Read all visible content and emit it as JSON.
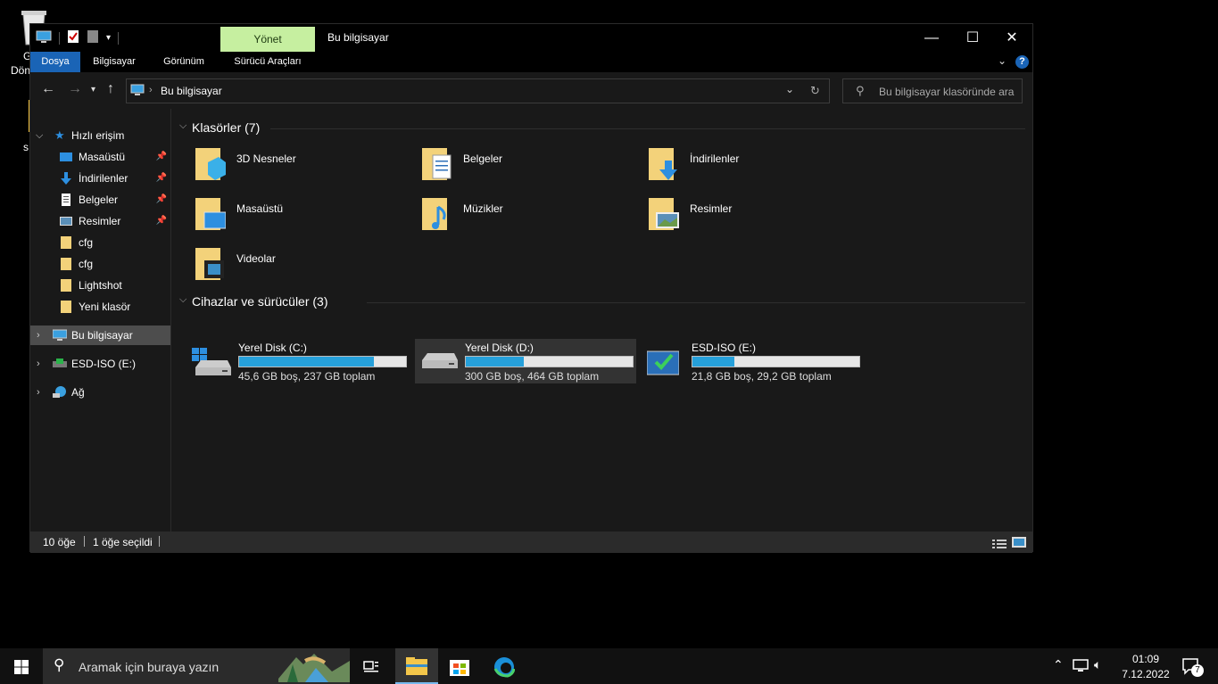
{
  "window": {
    "title": "Bu bilgisayar",
    "manage_tab": "Yönet",
    "controls": {
      "minimize": "—",
      "maximize": "☐",
      "close": "✕"
    }
  },
  "ribbon": {
    "tabs": [
      "Dosya",
      "Bilgisayar",
      "Görünüm",
      "Sürücü Araçları"
    ]
  },
  "address": {
    "path": "Bu bilgisayar",
    "search_placeholder": "Bu bilgisayar klasöründe ara"
  },
  "sidebar": {
    "quick_access": "Hızlı erişim",
    "items": [
      {
        "label": "Masaüstü",
        "icon": "desktop-icon",
        "pinned": true
      },
      {
        "label": "İndirilenler",
        "icon": "downloads-icon",
        "pinned": true
      },
      {
        "label": "Belgeler",
        "icon": "documents-icon",
        "pinned": true
      },
      {
        "label": "Resimler",
        "icon": "pictures-icon",
        "pinned": true
      },
      {
        "label": "cfg",
        "icon": "folder-icon",
        "pinned": false
      },
      {
        "label": "cfg",
        "icon": "folder-icon",
        "pinned": false
      },
      {
        "label": "Lightshot",
        "icon": "folder-icon",
        "pinned": false
      },
      {
        "label": "Yeni klasör",
        "icon": "folder-icon",
        "pinned": false
      }
    ],
    "this_pc": "Bu bilgisayar",
    "esd": "ESD-ISO (E:)",
    "network": "Ağ"
  },
  "content": {
    "folders_header": "Klasörler (7)",
    "folders": [
      "3D Nesneler",
      "Belgeler",
      "İndirilenler",
      "Masaüstü",
      "Müzikler",
      "Resimler",
      "Videolar"
    ],
    "drives_header": "Cihazlar ve sürücüler (3)",
    "drives": [
      {
        "name": "Yerel Disk (C:)",
        "info": "45,6 GB boş, 237 GB toplam",
        "used_fraction": 0.81
      },
      {
        "name": "Yerel Disk (D:)",
        "info": "300 GB boş, 464 GB toplam",
        "used_fraction": 0.35
      },
      {
        "name": "ESD-ISO (E:)",
        "info": "21,8 GB boş, 29,2 GB toplam",
        "used_fraction": 0.25
      }
    ]
  },
  "status": {
    "count": "10 öğe",
    "selected": "1 öğe seçildi"
  },
  "taskbar": {
    "search_placeholder": "Aramak için buraya yazın",
    "time": "01:09",
    "date": "7.12.2022",
    "notification_count": "7"
  },
  "desktop": {
    "recycle_label": "G\nDön",
    "other_label": "s"
  },
  "colors": {
    "accent": "#26a0da",
    "manage_tab": "#c6efa0",
    "file_tab": "#1a64b6"
  }
}
